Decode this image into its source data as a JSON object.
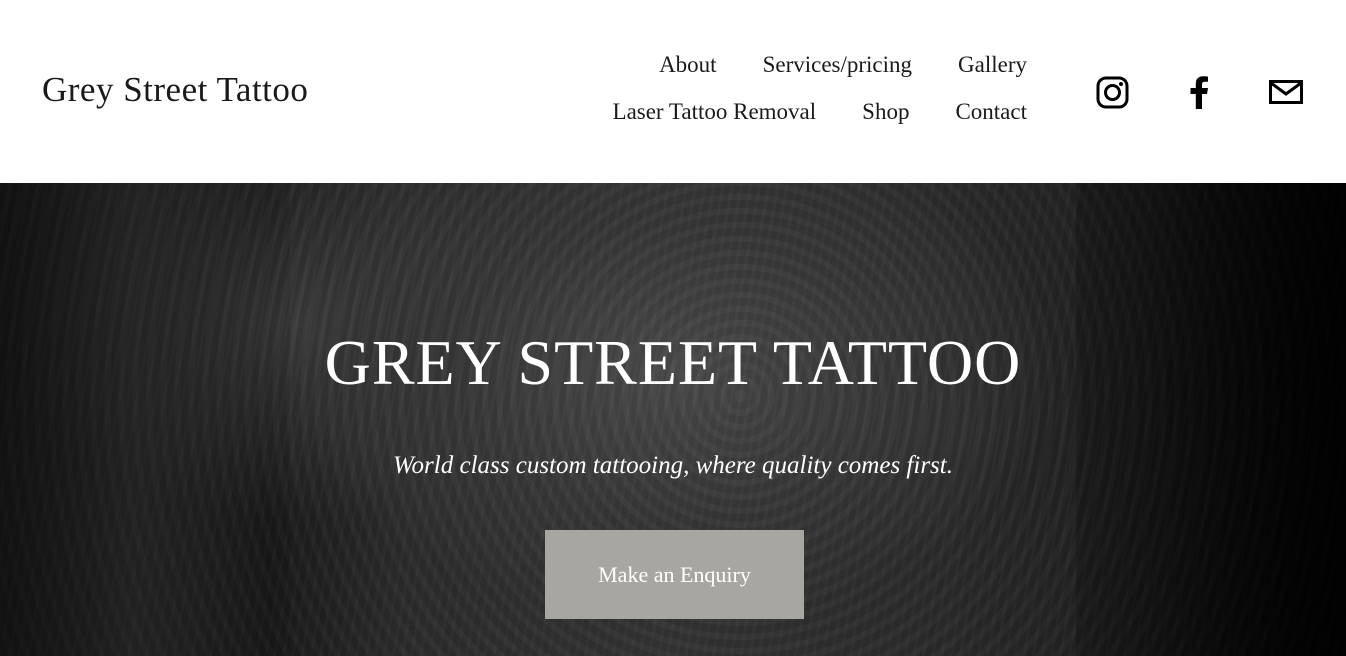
{
  "header": {
    "site_title": "Grey Street Tattoo",
    "nav": [
      {
        "label": "About"
      },
      {
        "label": "Services/pricing"
      },
      {
        "label": "Gallery"
      },
      {
        "label": "Laser Tattoo Removal"
      },
      {
        "label": "Shop"
      },
      {
        "label": "Contact"
      }
    ],
    "social_icons": [
      "instagram-icon",
      "facebook-icon",
      "email-icon"
    ]
  },
  "hero": {
    "heading": "GREY STREET TATTOO",
    "subheading": "World class custom tattooing, where quality comes first.",
    "cta_label": "Make an Enquiry",
    "cta_color": "#a7a6a1"
  }
}
